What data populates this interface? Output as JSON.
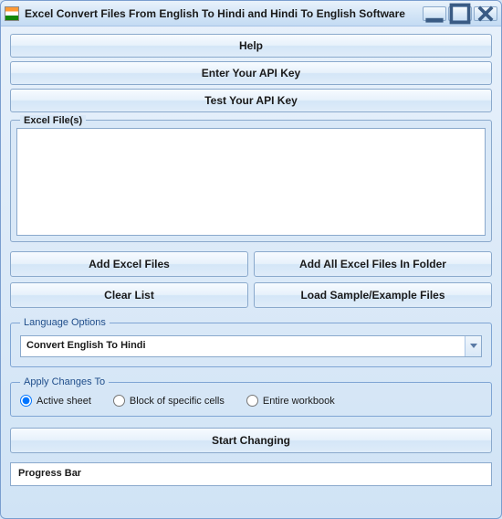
{
  "window": {
    "title": "Excel Convert Files From English To Hindi and Hindi To English Software"
  },
  "buttons": {
    "help": "Help",
    "enter_api": "Enter Your API Key",
    "test_api": "Test Your API Key",
    "add_files": "Add Excel Files",
    "add_folder": "Add All Excel Files In Folder",
    "clear_list": "Clear List",
    "load_sample": "Load Sample/Example Files",
    "start": "Start Changing"
  },
  "file_group": {
    "legend": "Excel File(s)"
  },
  "language_options": {
    "legend": "Language Options",
    "selected": "Convert English To Hindi"
  },
  "apply_changes": {
    "legend": "Apply Changes To",
    "options": {
      "active_sheet": "Active sheet",
      "block_cells": "Block of specific cells",
      "entire_workbook": "Entire workbook"
    },
    "selected": "active_sheet"
  },
  "progress": {
    "label": "Progress Bar"
  }
}
